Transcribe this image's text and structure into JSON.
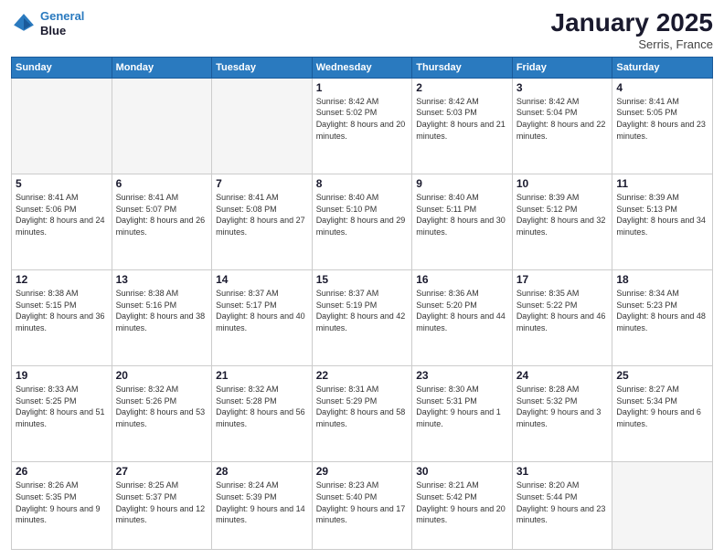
{
  "logo": {
    "line1": "General",
    "line2": "Blue"
  },
  "title": "January 2025",
  "subtitle": "Serris, France",
  "weekdays": [
    "Sunday",
    "Monday",
    "Tuesday",
    "Wednesday",
    "Thursday",
    "Friday",
    "Saturday"
  ],
  "weeks": [
    [
      {
        "day": "",
        "empty": true
      },
      {
        "day": "",
        "empty": true
      },
      {
        "day": "",
        "empty": true
      },
      {
        "day": "1",
        "sunrise": "8:42 AM",
        "sunset": "5:02 PM",
        "daylight": "8 hours and 20 minutes."
      },
      {
        "day": "2",
        "sunrise": "8:42 AM",
        "sunset": "5:03 PM",
        "daylight": "8 hours and 21 minutes."
      },
      {
        "day": "3",
        "sunrise": "8:42 AM",
        "sunset": "5:04 PM",
        "daylight": "8 hours and 22 minutes."
      },
      {
        "day": "4",
        "sunrise": "8:41 AM",
        "sunset": "5:05 PM",
        "daylight": "8 hours and 23 minutes."
      }
    ],
    [
      {
        "day": "5",
        "sunrise": "8:41 AM",
        "sunset": "5:06 PM",
        "daylight": "8 hours and 24 minutes."
      },
      {
        "day": "6",
        "sunrise": "8:41 AM",
        "sunset": "5:07 PM",
        "daylight": "8 hours and 26 minutes."
      },
      {
        "day": "7",
        "sunrise": "8:41 AM",
        "sunset": "5:08 PM",
        "daylight": "8 hours and 27 minutes."
      },
      {
        "day": "8",
        "sunrise": "8:40 AM",
        "sunset": "5:10 PM",
        "daylight": "8 hours and 29 minutes."
      },
      {
        "day": "9",
        "sunrise": "8:40 AM",
        "sunset": "5:11 PM",
        "daylight": "8 hours and 30 minutes."
      },
      {
        "day": "10",
        "sunrise": "8:39 AM",
        "sunset": "5:12 PM",
        "daylight": "8 hours and 32 minutes."
      },
      {
        "day": "11",
        "sunrise": "8:39 AM",
        "sunset": "5:13 PM",
        "daylight": "8 hours and 34 minutes."
      }
    ],
    [
      {
        "day": "12",
        "sunrise": "8:38 AM",
        "sunset": "5:15 PM",
        "daylight": "8 hours and 36 minutes."
      },
      {
        "day": "13",
        "sunrise": "8:38 AM",
        "sunset": "5:16 PM",
        "daylight": "8 hours and 38 minutes."
      },
      {
        "day": "14",
        "sunrise": "8:37 AM",
        "sunset": "5:17 PM",
        "daylight": "8 hours and 40 minutes."
      },
      {
        "day": "15",
        "sunrise": "8:37 AM",
        "sunset": "5:19 PM",
        "daylight": "8 hours and 42 minutes."
      },
      {
        "day": "16",
        "sunrise": "8:36 AM",
        "sunset": "5:20 PM",
        "daylight": "8 hours and 44 minutes."
      },
      {
        "day": "17",
        "sunrise": "8:35 AM",
        "sunset": "5:22 PM",
        "daylight": "8 hours and 46 minutes."
      },
      {
        "day": "18",
        "sunrise": "8:34 AM",
        "sunset": "5:23 PM",
        "daylight": "8 hours and 48 minutes."
      }
    ],
    [
      {
        "day": "19",
        "sunrise": "8:33 AM",
        "sunset": "5:25 PM",
        "daylight": "8 hours and 51 minutes."
      },
      {
        "day": "20",
        "sunrise": "8:32 AM",
        "sunset": "5:26 PM",
        "daylight": "8 hours and 53 minutes."
      },
      {
        "day": "21",
        "sunrise": "8:32 AM",
        "sunset": "5:28 PM",
        "daylight": "8 hours and 56 minutes."
      },
      {
        "day": "22",
        "sunrise": "8:31 AM",
        "sunset": "5:29 PM",
        "daylight": "8 hours and 58 minutes."
      },
      {
        "day": "23",
        "sunrise": "8:30 AM",
        "sunset": "5:31 PM",
        "daylight": "9 hours and 1 minute."
      },
      {
        "day": "24",
        "sunrise": "8:28 AM",
        "sunset": "5:32 PM",
        "daylight": "9 hours and 3 minutes."
      },
      {
        "day": "25",
        "sunrise": "8:27 AM",
        "sunset": "5:34 PM",
        "daylight": "9 hours and 6 minutes."
      }
    ],
    [
      {
        "day": "26",
        "sunrise": "8:26 AM",
        "sunset": "5:35 PM",
        "daylight": "9 hours and 9 minutes."
      },
      {
        "day": "27",
        "sunrise": "8:25 AM",
        "sunset": "5:37 PM",
        "daylight": "9 hours and 12 minutes."
      },
      {
        "day": "28",
        "sunrise": "8:24 AM",
        "sunset": "5:39 PM",
        "daylight": "9 hours and 14 minutes."
      },
      {
        "day": "29",
        "sunrise": "8:23 AM",
        "sunset": "5:40 PM",
        "daylight": "9 hours and 17 minutes."
      },
      {
        "day": "30",
        "sunrise": "8:21 AM",
        "sunset": "5:42 PM",
        "daylight": "9 hours and 20 minutes."
      },
      {
        "day": "31",
        "sunrise": "8:20 AM",
        "sunset": "5:44 PM",
        "daylight": "9 hours and 23 minutes."
      },
      {
        "day": "",
        "empty": true
      }
    ]
  ]
}
